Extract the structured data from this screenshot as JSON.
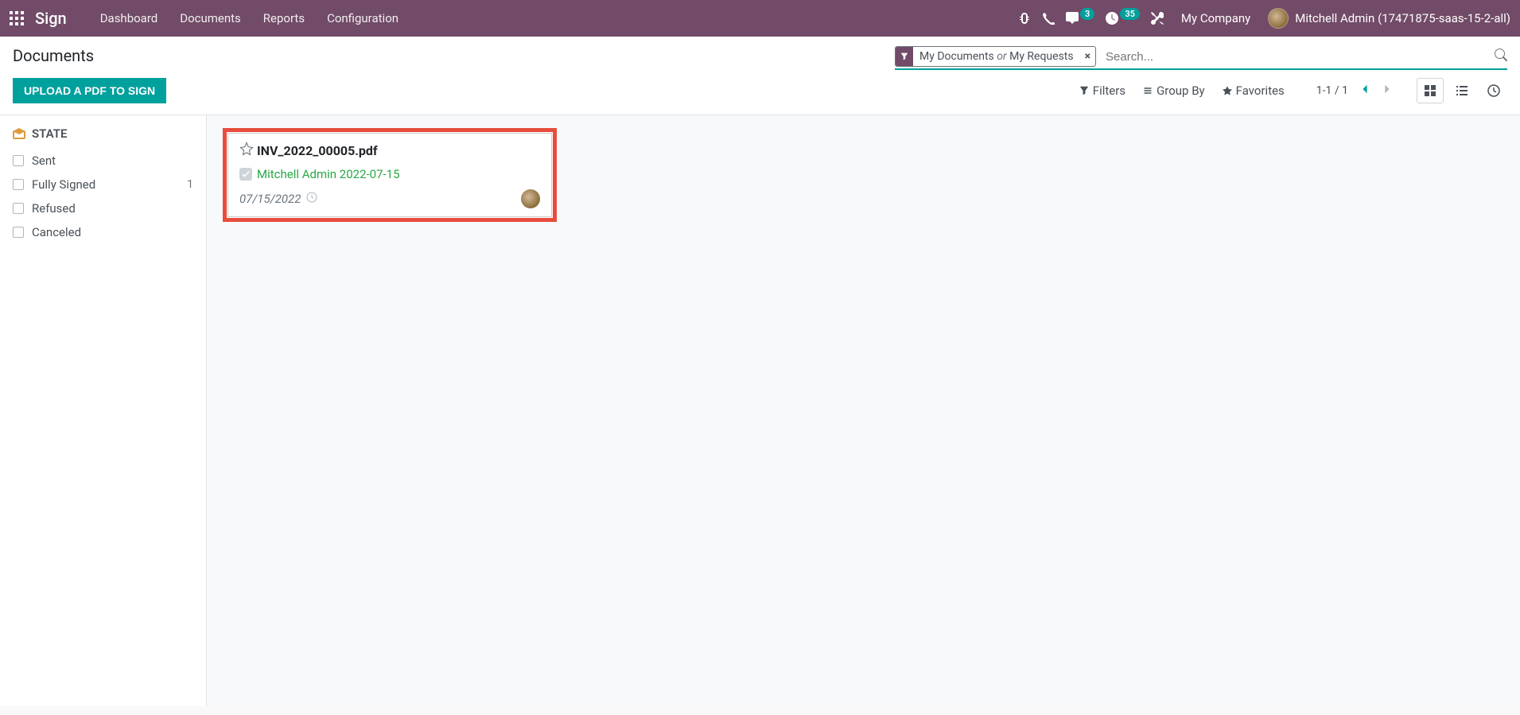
{
  "brand": "Sign",
  "nav": {
    "dashboard": "Dashboard",
    "documents": "Documents",
    "reports": "Reports",
    "configuration": "Configuration"
  },
  "systray": {
    "messages_badge": "3",
    "activities_badge": "35",
    "company": "My Company",
    "user_name": "Mitchell Admin (17471875-saas-15-2-all)"
  },
  "page": {
    "title": "Documents",
    "upload_btn": "UPLOAD A PDF TO SIGN"
  },
  "search": {
    "facet_a": "My Documents",
    "facet_or": "or",
    "facet_b": "My Requests",
    "placeholder": "Search...",
    "filters": "Filters",
    "group_by": "Group By",
    "favorites": "Favorites"
  },
  "pager": {
    "text": "1-1 / 1"
  },
  "sidebar": {
    "heading": "STATE",
    "items": [
      {
        "label": "Sent",
        "count": ""
      },
      {
        "label": "Fully Signed",
        "count": "1"
      },
      {
        "label": "Refused",
        "count": ""
      },
      {
        "label": "Canceled",
        "count": ""
      }
    ]
  },
  "card": {
    "title": "INV_2022_00005.pdf",
    "signer": "Mitchell Admin 2022-07-15",
    "date": "07/15/2022"
  }
}
